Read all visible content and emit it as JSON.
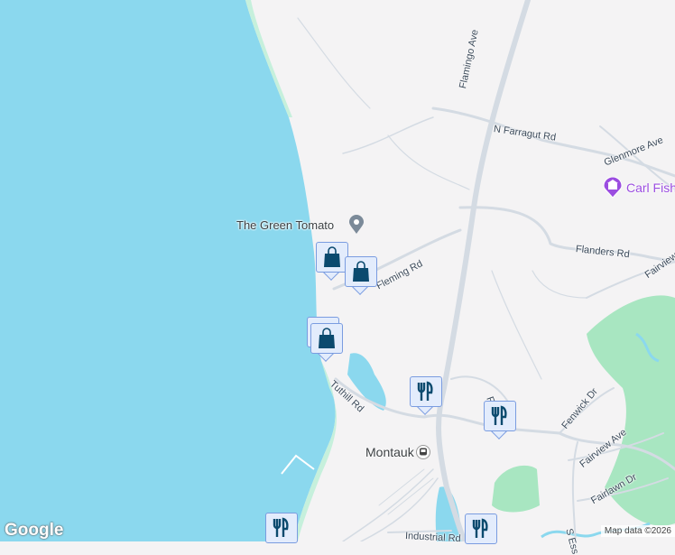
{
  "map": {
    "colors": {
      "water": "#8bd8ee",
      "land": "#f4f3f4",
      "park": "#a8e6c1",
      "road": "#d4dbe3",
      "marker": "#0b4a6e",
      "marker_bg": "#e3ecfc",
      "museum": "#9b4de0"
    },
    "roads": [
      "Flamingo Ave",
      "N Farragut Rd",
      "Glenmore Ave",
      "Flanders Rd",
      "Fairview",
      "Fleming Rd",
      "Tuthill Rd",
      "Fer",
      "Fenwick Dr",
      "Fairview Ave",
      "Fairlawn Dr",
      "S Ess",
      "Industrial Rd"
    ],
    "places": [
      {
        "name": "The Green Tomato",
        "icon": "location-pin-icon"
      },
      {
        "name": "Carl Fish",
        "icon": "museum-icon"
      },
      {
        "name": "Montauk",
        "icon": "train-station-icon"
      }
    ],
    "markers": [
      "shopping-bag-icon",
      "shopping-bag-icon",
      "restaurant-icon",
      "shopping-bag-icon",
      "restaurant-icon",
      "restaurant-icon",
      "restaurant-icon"
    ],
    "logo": "Google",
    "attribution": "Map data ©2026"
  }
}
